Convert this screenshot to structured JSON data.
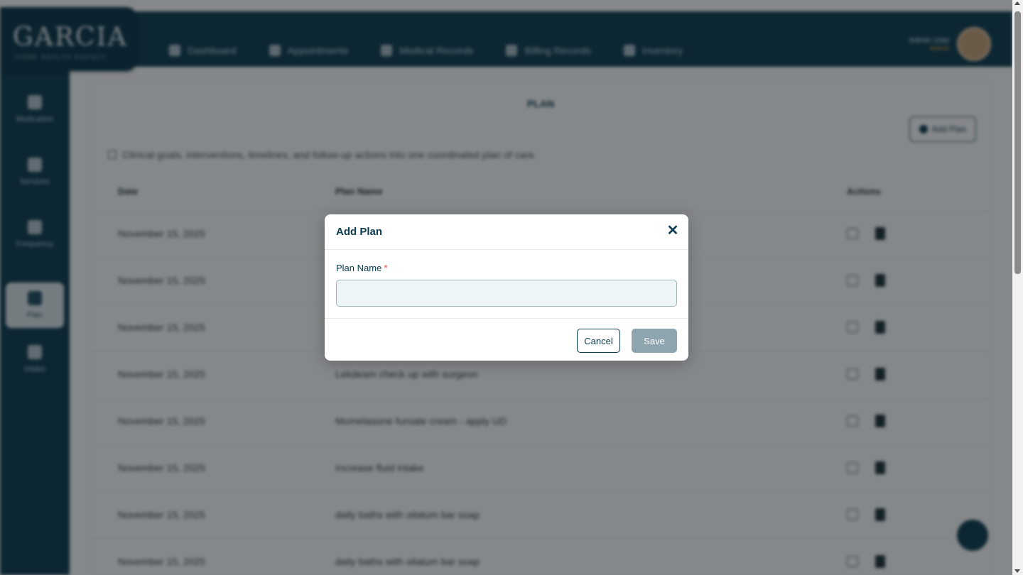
{
  "header": {
    "logo_text": "GARCIA",
    "logo_subtext": "HOME HEALTH AGENCY",
    "nav": [
      {
        "label": "Dashboard",
        "icon": "dashboard-icon"
      },
      {
        "label": "Appointments",
        "icon": "calendar-icon"
      },
      {
        "label": "Medical Records",
        "icon": "medical-records-icon"
      },
      {
        "label": "Billing Records",
        "icon": "billing-icon"
      },
      {
        "label": "Inventory",
        "icon": "inventory-icon"
      }
    ],
    "user_name": "Admin User",
    "user_role": "Admin"
  },
  "sidebar": {
    "items": [
      {
        "label": "Medication",
        "icon": "pill-icon"
      },
      {
        "label": "Services",
        "icon": "services-icon"
      },
      {
        "label": "Frequency",
        "icon": "frequency-icon"
      },
      {
        "label": "Plan",
        "icon": "plan-icon",
        "active": true
      },
      {
        "label": "Intake",
        "icon": "intake-icon"
      }
    ]
  },
  "page": {
    "title": "PLAN",
    "add_button": "Add Plan",
    "info_text": "Clinical goals, interventions, timelines, and follow-up actions into one coordinated plan of care.",
    "columns": {
      "date": "Date",
      "plan_name": "Plan Name",
      "actions": "Actions"
    },
    "rows": [
      {
        "date": "November 15, 2025",
        "plan_name": ""
      },
      {
        "date": "November 15, 2025",
        "plan_name": ""
      },
      {
        "date": "November 15, 2025",
        "plan_name": ""
      },
      {
        "date": "November 15, 2025",
        "plan_name": "Lekdeam check up with surgeon"
      },
      {
        "date": "November 15, 2025",
        "plan_name": "Mometasone furoate cream - apply UD"
      },
      {
        "date": "November 15, 2025",
        "plan_name": "Increase fluid intake"
      },
      {
        "date": "November 15, 2025",
        "plan_name": "daily baths with oilatum bar soap"
      },
      {
        "date": "November 15, 2025",
        "plan_name": "daily baths with oilatum bar soap"
      }
    ]
  },
  "modal": {
    "title": "Add Plan",
    "close_symbol": "✕",
    "field_label": "Plan Name",
    "required_mark": "*",
    "field_value": "",
    "field_placeholder": "",
    "cancel_label": "Cancel",
    "save_label": "Save"
  },
  "colors": {
    "primary": "#0c3b4f",
    "save_disabled": "#8ea5b0",
    "required": "#e53935",
    "input_bg": "#eef5f7"
  }
}
